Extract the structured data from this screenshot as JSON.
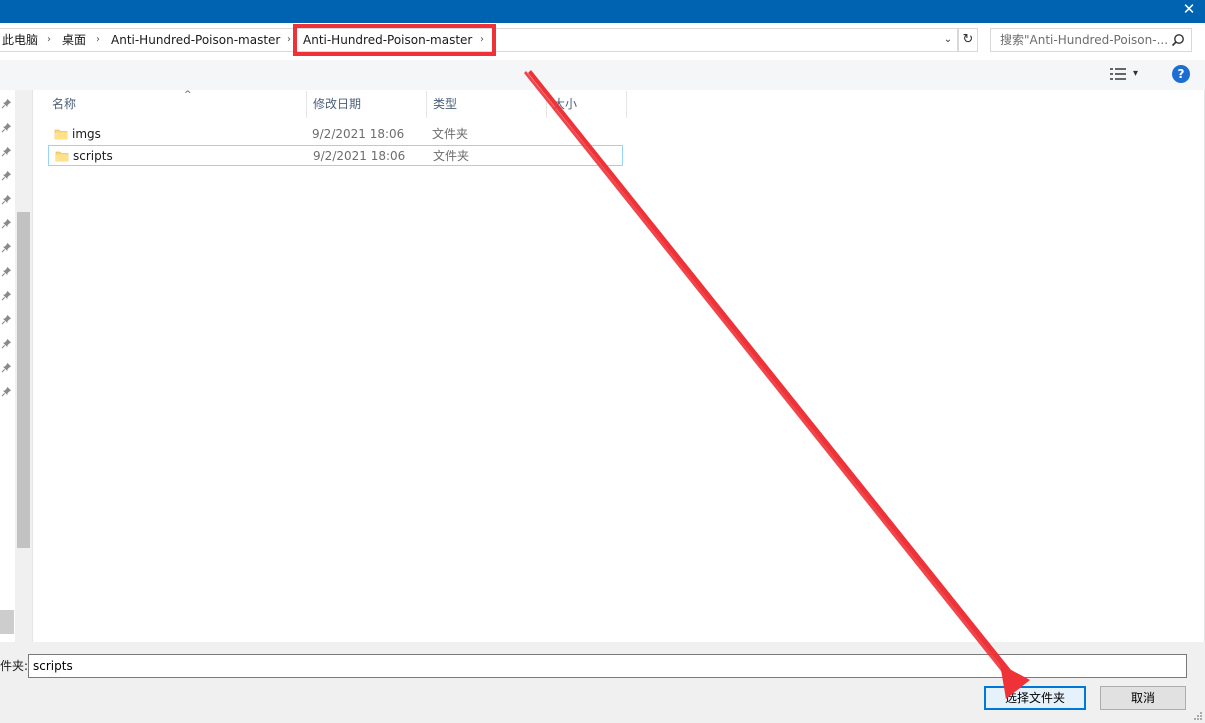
{
  "window": {
    "close_glyph": "✕"
  },
  "address": {
    "crumbs": [
      "此电脑",
      "桌面",
      "Anti-Hundred-Poison-master",
      "Anti-Hundred-Poison-master"
    ],
    "separator": "›",
    "dropdown_glyph": "⌄",
    "refresh_glyph": "↻"
  },
  "search": {
    "placeholder": "搜索\"Anti-Hundred-Poison-..."
  },
  "toolbar": {
    "view_arrow": "▾",
    "help_label": "?"
  },
  "columns": {
    "name": "名称",
    "modified": "修改日期",
    "type": "类型",
    "size": "大小",
    "sort_glyph": "^"
  },
  "files": [
    {
      "name": "imgs",
      "modified": "9/2/2021 18:06",
      "type": "文件夹",
      "selected": false
    },
    {
      "name": "scripts",
      "modified": "9/2/2021 18:06",
      "type": "文件夹",
      "selected": true
    }
  ],
  "bottom": {
    "folder_label": "件夹:",
    "folder_value": "scripts",
    "select_button": "选择文件夹",
    "cancel_button": "取消"
  },
  "colors": {
    "titlebar": "#0063b1",
    "highlight_red": "#ee3237",
    "selection_border": "#99d1ff",
    "primary_button_border": "#0078d7"
  },
  "icons": {
    "pin": "pin-icon",
    "folder": "folder-icon",
    "search": "search-icon",
    "view": "details-view-icon",
    "help": "help-icon"
  }
}
